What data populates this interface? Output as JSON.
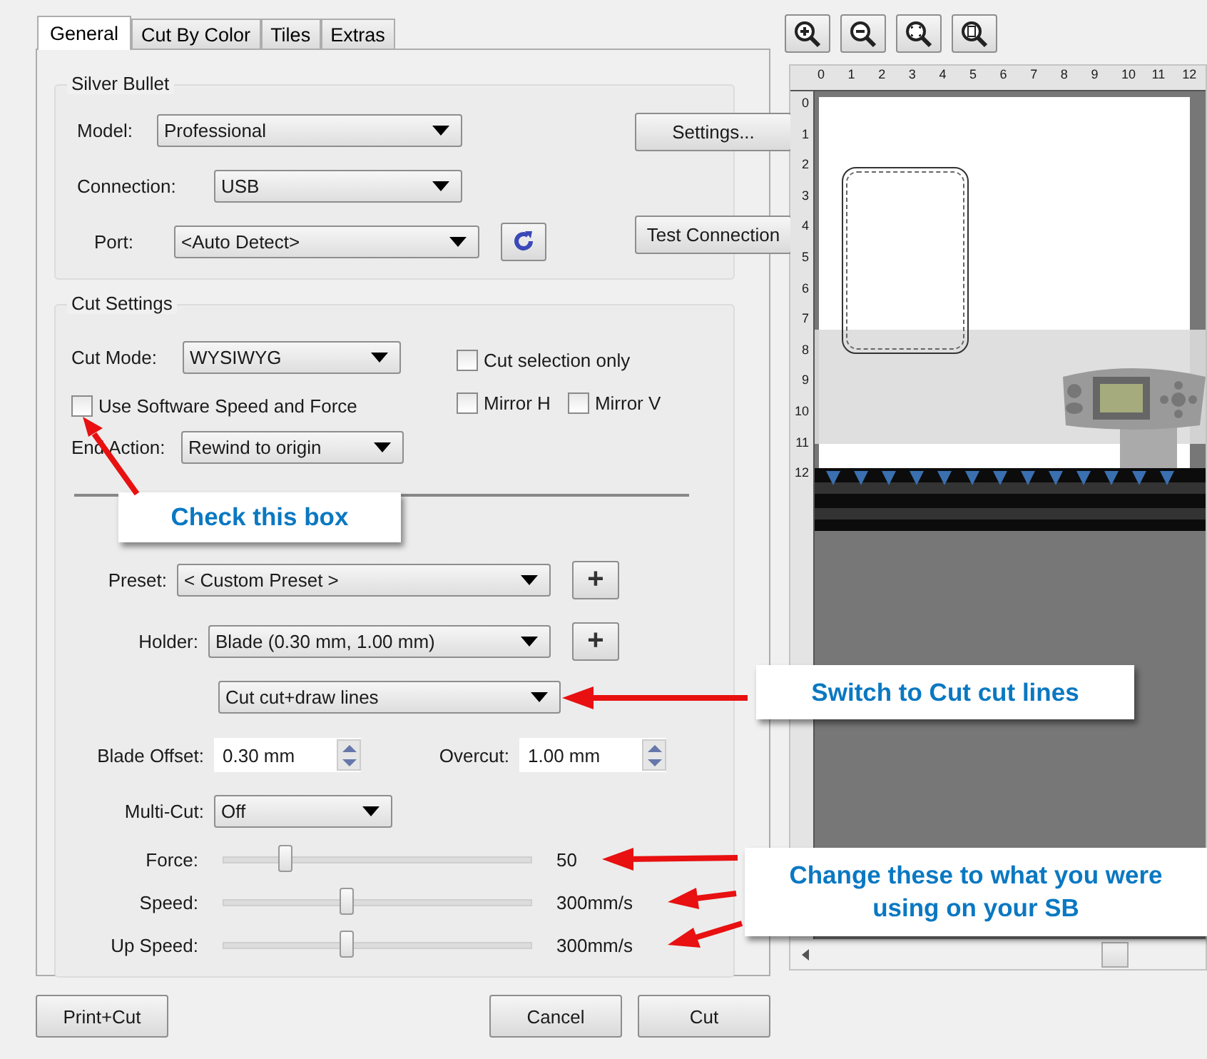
{
  "tabs": [
    {
      "label": "General",
      "selected": true
    },
    {
      "label": "Cut By Color",
      "selected": false
    },
    {
      "label": "Tiles",
      "selected": false
    },
    {
      "label": "Extras",
      "selected": false
    }
  ],
  "silver_bullet": {
    "title": "Silver Bullet",
    "model_label": "Model:",
    "model": "Professional",
    "connection_label": "Connection:",
    "connection": "USB",
    "port_label": "Port:",
    "port": "<Auto Detect>",
    "settings_button": "Settings...",
    "test_button": "Test Connection"
  },
  "cut_settings": {
    "title": "Cut Settings",
    "cut_mode_label": "Cut Mode:",
    "cut_mode": "WYSIWYG",
    "checkboxes": [
      {
        "label": "Cut selection only",
        "checked": false
      },
      {
        "label": "Mirror H",
        "checked": false
      },
      {
        "label": "Mirror V",
        "checked": false
      }
    ],
    "software_speed": {
      "label": "Use Software Speed and Force",
      "checked": false
    },
    "end_action_label": "End Action:",
    "end_action": "Rewind to origin",
    "preset_label": "Preset:",
    "preset": "< Custom Preset >",
    "holder_label": "Holder:",
    "holder": "Blade (0.30 mm, 1.00 mm)",
    "add_button": "+",
    "line_mode": "Cut cut+draw lines",
    "blade_offset_label": "Blade Offset:",
    "blade_offset": "0.30 mm",
    "overcut_label": "Overcut:",
    "overcut": "1.00 mm",
    "multi_cut_label": "Multi-Cut:",
    "multi_cut": "Off",
    "sliders": [
      {
        "label": "Force:",
        "level": 0.2,
        "reading": "50"
      },
      {
        "label": "Speed:",
        "level": 0.4,
        "reading": "300mm/s"
      },
      {
        "label": "Up Speed:",
        "level": 0.4,
        "reading": "300mm/s"
      }
    ]
  },
  "buttons": {
    "print_cut": "Print+Cut",
    "cancel": "Cancel",
    "cut": "Cut"
  },
  "ruler": {
    "x_ticks": [
      "0",
      "1",
      "2",
      "3",
      "4",
      "5",
      "6",
      "7",
      "8",
      "9",
      "10",
      "11",
      "12"
    ],
    "y_ticks": [
      "0",
      "1",
      "2",
      "3",
      "4",
      "5",
      "6",
      "7",
      "8",
      "9",
      "10",
      "11",
      "12"
    ]
  },
  "callouts": [
    "Check this box",
    "Switch to Cut cut lines",
    "Change these to what you were using on your SB"
  ]
}
